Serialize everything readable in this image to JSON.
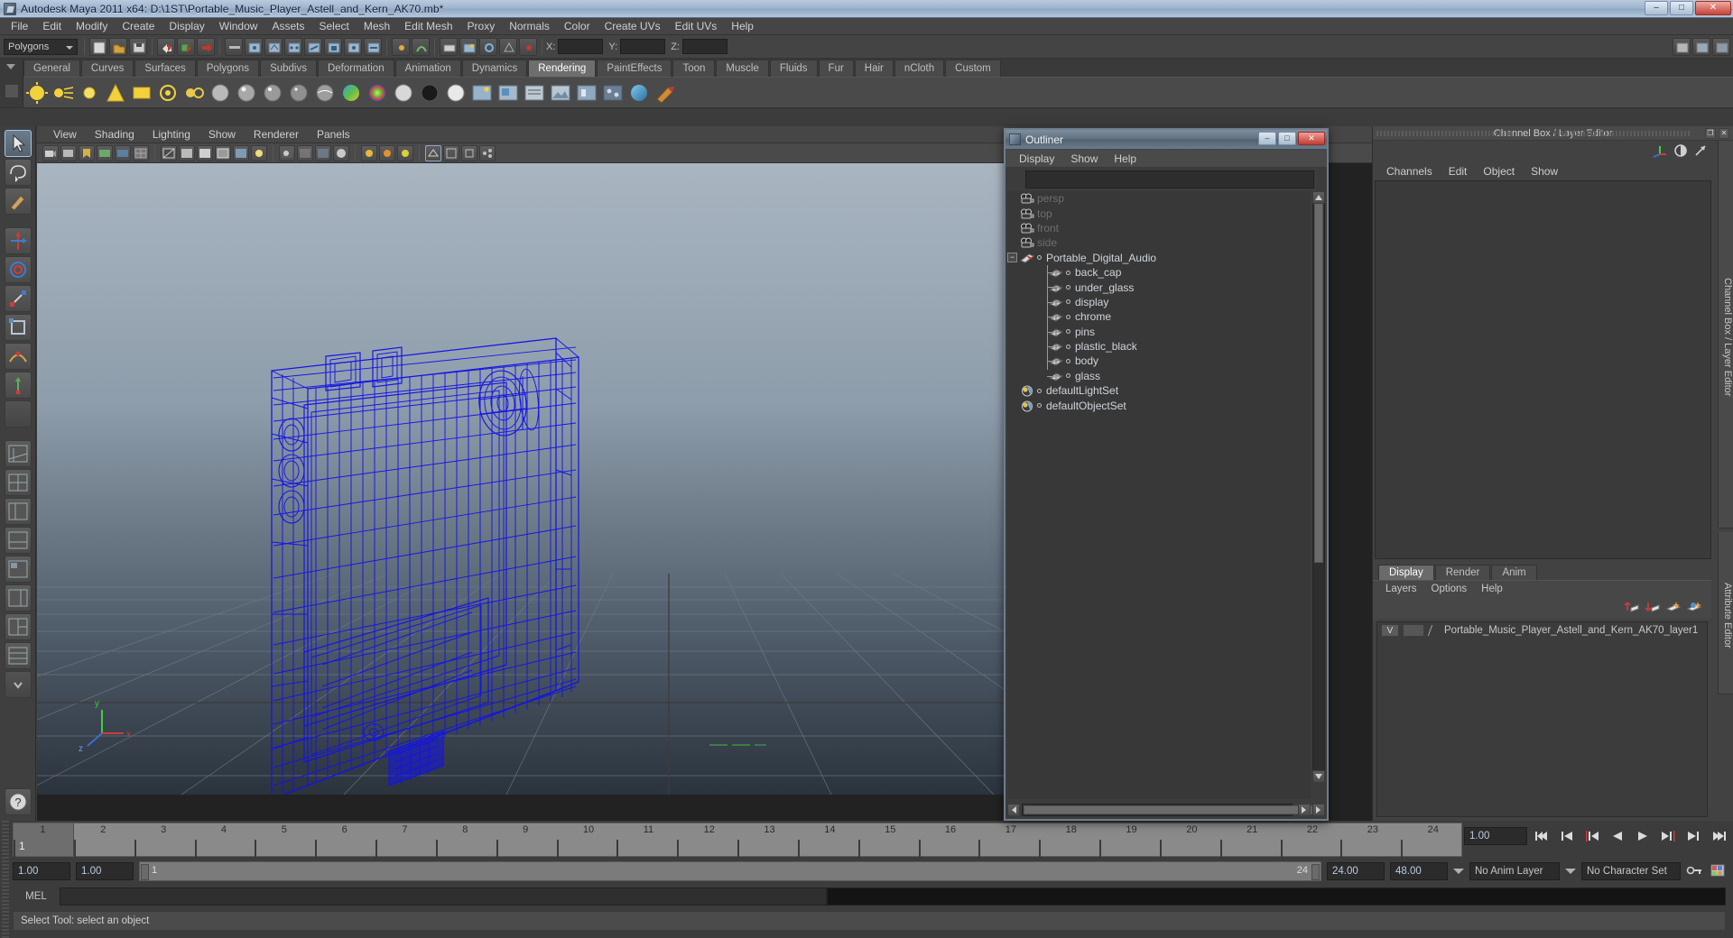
{
  "window": {
    "title": "Autodesk Maya 2011 x64: D:\\1ST\\Portable_Music_Player_Astell_and_Kern_AK70.mb*",
    "minimize": "–",
    "maximize": "□",
    "close": "✕"
  },
  "menubar": {
    "items": [
      {
        "label": "File"
      },
      {
        "label": "Edit"
      },
      {
        "label": "Modify"
      },
      {
        "label": "Create"
      },
      {
        "label": "Display"
      },
      {
        "label": "Window"
      },
      {
        "label": "Assets"
      },
      {
        "label": "Select"
      },
      {
        "label": "Mesh"
      },
      {
        "label": "Edit Mesh"
      },
      {
        "label": "Proxy"
      },
      {
        "label": "Normals"
      },
      {
        "label": "Color"
      },
      {
        "label": "Create UVs"
      },
      {
        "label": "Edit UVs"
      },
      {
        "label": "Help"
      }
    ]
  },
  "statusline": {
    "mode_selector": "Polygons",
    "coord_labels": [
      "X:",
      "Y:",
      "Z:"
    ],
    "coord_values": [
      "",
      "",
      ""
    ]
  },
  "shelf": {
    "tabs": [
      {
        "label": "General",
        "active": false
      },
      {
        "label": "Curves",
        "active": false
      },
      {
        "label": "Surfaces",
        "active": false
      },
      {
        "label": "Polygons",
        "active": false
      },
      {
        "label": "Subdivs",
        "active": false
      },
      {
        "label": "Deformation",
        "active": false
      },
      {
        "label": "Animation",
        "active": false
      },
      {
        "label": "Dynamics",
        "active": false
      },
      {
        "label": "Rendering",
        "active": true
      },
      {
        "label": "PaintEffects",
        "active": false
      },
      {
        "label": "Toon",
        "active": false
      },
      {
        "label": "Muscle",
        "active": false
      },
      {
        "label": "Fluids",
        "active": false
      },
      {
        "label": "Fur",
        "active": false
      },
      {
        "label": "Hair",
        "active": false
      },
      {
        "label": "nCloth",
        "active": false
      },
      {
        "label": "Custom",
        "active": false
      }
    ]
  },
  "viewport": {
    "menu": [
      {
        "label": "View"
      },
      {
        "label": "Shading"
      },
      {
        "label": "Lighting"
      },
      {
        "label": "Show"
      },
      {
        "label": "Renderer"
      },
      {
        "label": "Panels"
      }
    ],
    "axis": {
      "x": "x",
      "y": "y",
      "z": "z"
    },
    "wireframe_color": "#1414e6",
    "background_top": "#9aa7b4",
    "background_bottom": "#2a3340"
  },
  "outliner": {
    "title": "Outliner",
    "menu": [
      {
        "label": "Display"
      },
      {
        "label": "Show"
      },
      {
        "label": "Help"
      }
    ],
    "minimize": "–",
    "maximize": "□",
    "close": "✕",
    "items": [
      {
        "label": "persp",
        "icon": "camera-icon",
        "style": "dim",
        "indent": 0
      },
      {
        "label": "top",
        "icon": "camera-icon",
        "style": "dim",
        "indent": 0
      },
      {
        "label": "front",
        "icon": "camera-icon",
        "style": "dim",
        "indent": 0
      },
      {
        "label": "side",
        "icon": "camera-icon",
        "style": "dim",
        "indent": 0
      },
      {
        "label": "Portable_Digital_Audio",
        "icon": "group-icon",
        "style": "lit",
        "indent": 0,
        "expanded": true
      },
      {
        "label": "back_cap",
        "icon": "mesh-icon",
        "style": "lit",
        "indent": 1
      },
      {
        "label": "under_glass",
        "icon": "mesh-icon",
        "style": "lit",
        "indent": 1
      },
      {
        "label": "display",
        "icon": "mesh-icon",
        "style": "lit",
        "indent": 1
      },
      {
        "label": "chrome",
        "icon": "mesh-icon",
        "style": "lit",
        "indent": 1
      },
      {
        "label": "pins",
        "icon": "mesh-icon",
        "style": "lit",
        "indent": 1
      },
      {
        "label": "plastic_black",
        "icon": "mesh-icon",
        "style": "lit",
        "indent": 1
      },
      {
        "label": "body",
        "icon": "mesh-icon",
        "style": "lit",
        "indent": 1
      },
      {
        "label": "glass",
        "icon": "mesh-icon",
        "style": "lit",
        "indent": 1
      },
      {
        "label": "defaultLightSet",
        "icon": "set-icon",
        "style": "lit",
        "indent": 0
      },
      {
        "label": "defaultObjectSet",
        "icon": "set-icon",
        "style": "lit",
        "indent": 0
      }
    ]
  },
  "rightdock": {
    "title": "Channel Box / Layer Editor",
    "restore": "❐",
    "close": "✕",
    "menu": [
      {
        "label": "Channels"
      },
      {
        "label": "Edit"
      },
      {
        "label": "Object"
      },
      {
        "label": "Show"
      }
    ],
    "side_tab_1": "Channel Box / Layer Editor",
    "side_tab_2": "Attribute Editor",
    "layer_editor": {
      "tabs": [
        {
          "label": "Display",
          "active": true
        },
        {
          "label": "Render",
          "active": false
        },
        {
          "label": "Anim",
          "active": false
        }
      ],
      "menu": [
        {
          "label": "Layers"
        },
        {
          "label": "Options"
        },
        {
          "label": "Help"
        }
      ],
      "layers": [
        {
          "visibility": "V",
          "name": "Portable_Music_Player_Astell_and_Kern_AK70_layer1"
        }
      ]
    }
  },
  "timeline": {
    "ticks": [
      "1",
      "2",
      "3",
      "4",
      "5",
      "6",
      "7",
      "8",
      "9",
      "10",
      "11",
      "12",
      "13",
      "14",
      "15",
      "16",
      "17",
      "18",
      "19",
      "20",
      "21",
      "22",
      "23",
      "24"
    ],
    "current_frame_label": "1",
    "current_time_field": "1.00",
    "playback_buttons": [
      {
        "name": "go-to-start-button",
        "glyph": "⏮"
      },
      {
        "name": "step-back-frame-button",
        "glyph": "⏴"
      },
      {
        "name": "step-back-key-button",
        "glyph": "⏴"
      },
      {
        "name": "play-backwards-button",
        "glyph": "◀"
      },
      {
        "name": "play-forwards-button",
        "glyph": "▶"
      },
      {
        "name": "step-forward-key-button",
        "glyph": "⏵"
      },
      {
        "name": "step-forward-frame-button",
        "glyph": "⏵"
      },
      {
        "name": "go-to-end-button",
        "glyph": "⏭"
      }
    ]
  },
  "rangeslider": {
    "anim_start": "1.00",
    "range_start": "1.00",
    "range_bar_start": "1",
    "range_bar_end": "24",
    "range_end": "24.00",
    "anim_end": "48.00",
    "anim_layer": "No Anim Layer",
    "character_set": "No Character Set"
  },
  "commandline": {
    "label": "MEL",
    "value": ""
  },
  "helpline": {
    "text": "Select Tool: select an object"
  }
}
